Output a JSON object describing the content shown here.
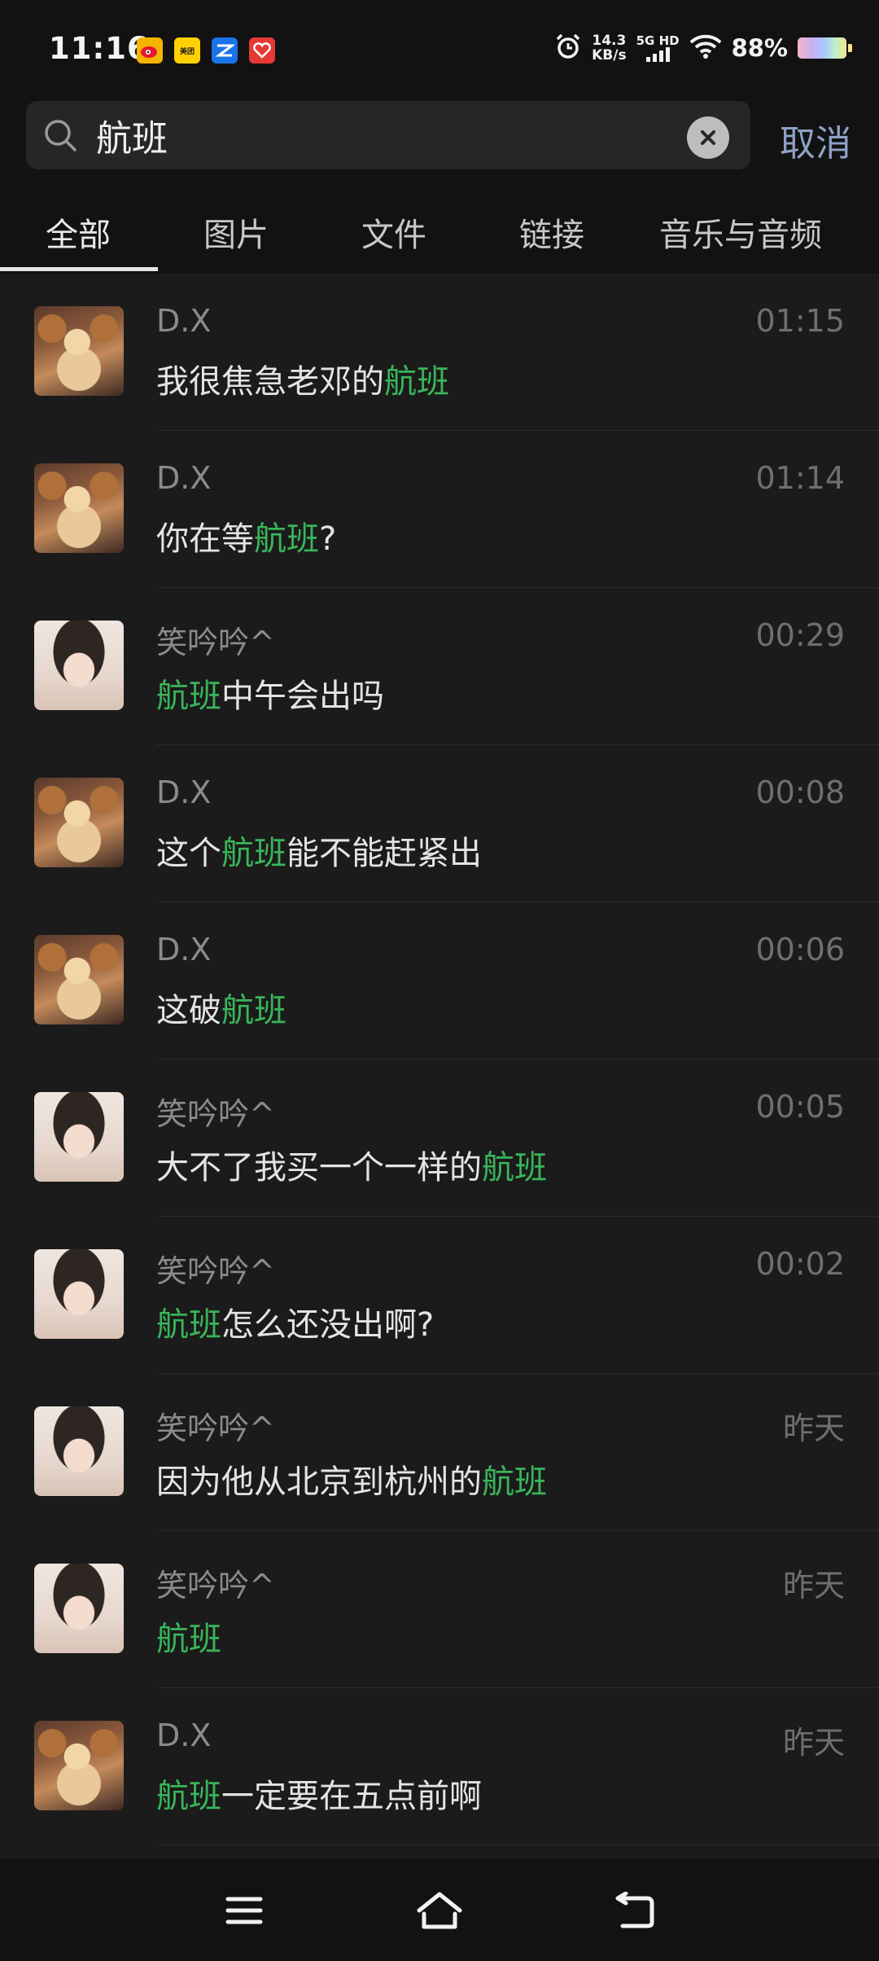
{
  "status_bar": {
    "time": "11:16",
    "app_icons": [
      "weibo-icon",
      "meituan-icon",
      "zte-icon",
      "heart-app-icon"
    ],
    "meituan_label": "美团",
    "net_speed_value": "14.3",
    "net_speed_unit": "KB/s",
    "network_type": "5G HD",
    "battery_percent": "88%"
  },
  "search": {
    "query": "航班",
    "cancel_label": "取消"
  },
  "tabs": [
    {
      "label": "全部",
      "active": true
    },
    {
      "label": "图片",
      "active": false
    },
    {
      "label": "文件",
      "active": false
    },
    {
      "label": "链接",
      "active": false
    },
    {
      "label": "音乐与音频",
      "active": false
    }
  ],
  "results": [
    {
      "avatar": "cat",
      "name": "D.X",
      "time": "01:15",
      "msg": {
        "pre": "我很焦急老邓的",
        "hl": "航班",
        "post": ""
      }
    },
    {
      "avatar": "cat",
      "name": "D.X",
      "time": "01:14",
      "msg": {
        "pre": "你在等",
        "hl": "航班",
        "post": "?"
      }
    },
    {
      "avatar": "girl",
      "name": "笑吟吟^",
      "time": "00:29",
      "msg": {
        "pre": "",
        "hl": "航班",
        "post": "中午会出吗"
      }
    },
    {
      "avatar": "cat",
      "name": "D.X",
      "time": "00:08",
      "msg": {
        "pre": "这个",
        "hl": "航班",
        "post": "能不能赶紧出"
      }
    },
    {
      "avatar": "cat",
      "name": "D.X",
      "time": "00:06",
      "msg": {
        "pre": "这破",
        "hl": "航班",
        "post": ""
      }
    },
    {
      "avatar": "girl",
      "name": "笑吟吟^",
      "time": "00:05",
      "msg": {
        "pre": "大不了我买一个一样的",
        "hl": "航班",
        "post": ""
      }
    },
    {
      "avatar": "girl",
      "name": "笑吟吟^",
      "time": "00:02",
      "msg": {
        "pre": "",
        "hl": "航班",
        "post": "怎么还没出啊?"
      }
    },
    {
      "avatar": "girl",
      "name": "笑吟吟^",
      "time": "昨天",
      "msg": {
        "pre": "因为他从北京到杭州的",
        "hl": "航班",
        "post": ""
      }
    },
    {
      "avatar": "girl",
      "name": "笑吟吟^",
      "time": "昨天",
      "msg": {
        "pre": "",
        "hl": "航班",
        "post": ""
      }
    },
    {
      "avatar": "cat",
      "name": "D.X",
      "time": "昨天",
      "msg": {
        "pre": "",
        "hl": "航班",
        "post": "一定要在五点前啊"
      }
    }
  ],
  "colors": {
    "highlight": "#39b55a",
    "background": "#1b1b1b",
    "cancel": "#8ea2c4"
  },
  "bottom_nav": [
    "menu-icon",
    "home-icon",
    "back-icon"
  ]
}
